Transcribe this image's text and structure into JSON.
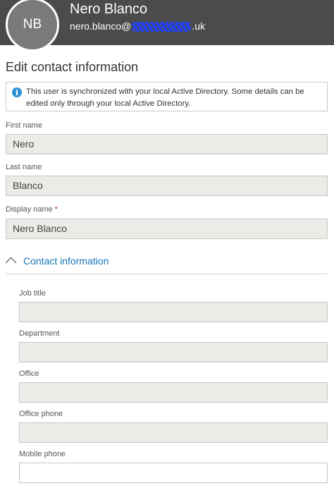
{
  "user": {
    "initials": "NB",
    "name": "Nero Blanco",
    "email_prefix": "nero.blanco@",
    "email_suffix": ".uk"
  },
  "page_title": "Edit contact information",
  "notice": {
    "text": "This user is synchronized with your local Active Directory. Some details can be edited only through your local Active Directory."
  },
  "fields": {
    "first_name": {
      "label": "First name",
      "value": "Nero"
    },
    "last_name": {
      "label": "Last name",
      "value": "Blanco"
    },
    "display_name": {
      "label": "Display name",
      "required_mark": "*",
      "value": "Nero Blanco"
    }
  },
  "contact_section": {
    "label": "Contact information",
    "fields": {
      "job_title": {
        "label": "Job title",
        "value": ""
      },
      "department": {
        "label": "Department",
        "value": ""
      },
      "office": {
        "label": "Office",
        "value": ""
      },
      "office_phone": {
        "label": "Office phone",
        "value": ""
      },
      "mobile_phone": {
        "label": "Mobile phone",
        "value": ""
      }
    }
  }
}
